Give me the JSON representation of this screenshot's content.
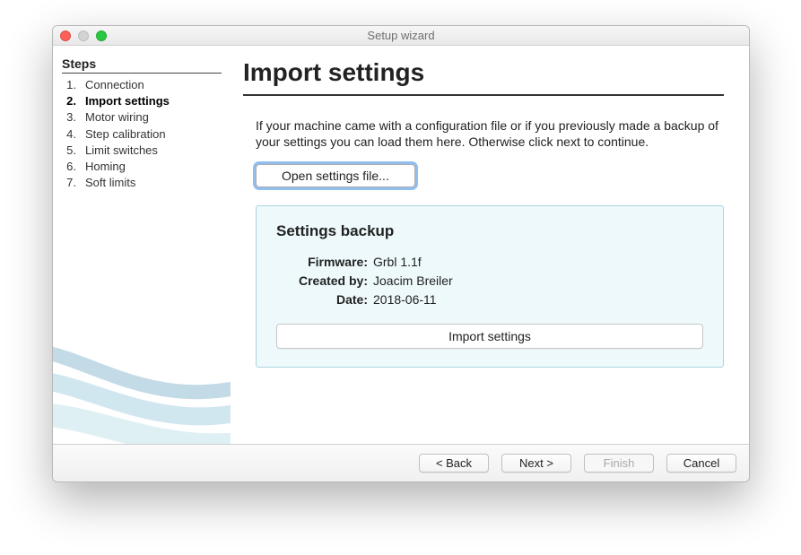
{
  "window": {
    "title": "Setup wizard"
  },
  "sidebar": {
    "heading": "Steps",
    "steps": [
      {
        "num": "1.",
        "label": "Connection"
      },
      {
        "num": "2.",
        "label": "Import settings"
      },
      {
        "num": "3.",
        "label": "Motor wiring"
      },
      {
        "num": "4.",
        "label": "Step calibration"
      },
      {
        "num": "5.",
        "label": "Limit switches"
      },
      {
        "num": "6.",
        "label": "Homing"
      },
      {
        "num": "7.",
        "label": "Soft limits"
      }
    ],
    "currentIndex": 1
  },
  "main": {
    "title": "Import settings",
    "intro": "If your machine came with a configuration file or if you previously made a backup of your settings you can load them here. Otherwise click next to continue.",
    "openFileLabel": "Open settings file...",
    "backup": {
      "heading": "Settings backup",
      "firmwareLabel": "Firmware:",
      "firmwareValue": "Grbl 1.1f",
      "createdByLabel": "Created by:",
      "createdByValue": "Joacim Breiler",
      "dateLabel": "Date:",
      "dateValue": "2018-06-11",
      "importLabel": "Import settings"
    }
  },
  "nav": {
    "back": "< Back",
    "next": "Next >",
    "finish": "Finish",
    "cancel": "Cancel"
  }
}
